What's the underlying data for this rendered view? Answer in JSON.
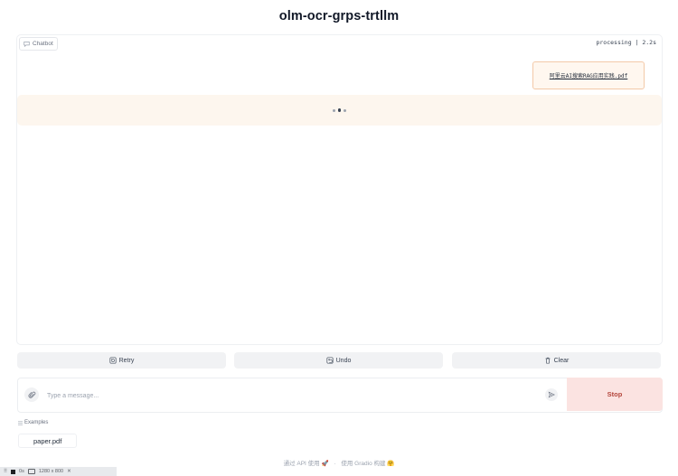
{
  "app": {
    "title": "olm-ocr-grps-trtllm"
  },
  "chatbot": {
    "label": "Chatbot",
    "status": "processing | 2.2s",
    "messages": [
      {
        "role": "user",
        "file_name": "阿里云AI搜索RAG应用实践.pdf"
      }
    ]
  },
  "actions": {
    "retry": "Retry",
    "undo": "Undo",
    "clear": "Clear"
  },
  "input": {
    "placeholder": "Type a message...",
    "value": "",
    "stop_label": "Stop"
  },
  "examples": {
    "label": "Examples",
    "items": [
      "paper.pdf"
    ]
  },
  "footer": {
    "api_text": "通过 API 使用",
    "api_icon": "🚀",
    "separator": "·",
    "gradio_text": "使用 Gradio 构建",
    "gradio_icon": "🤗"
  },
  "devbar": {
    "time": "0s",
    "size": "1280 x 800",
    "close": "✕"
  }
}
